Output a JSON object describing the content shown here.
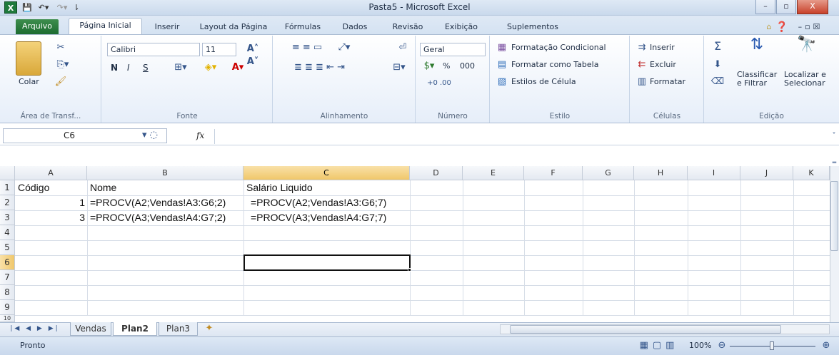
{
  "window": {
    "title": "Pasta5  -  Microsoft Excel",
    "app_icon": "X",
    "controls": [
      "–",
      "▫",
      "X"
    ]
  },
  "tabs": [
    "Arquivo",
    "Página Inicial",
    "Inserir",
    "Layout da Página",
    "Fórmulas",
    "Dados",
    "Revisão",
    "Exibição",
    "Suplementos"
  ],
  "ribbon": {
    "clipboard": {
      "label": "Área de Transf...",
      "paste": "Colar"
    },
    "font": {
      "label": "Fonte",
      "name": "Calibri",
      "size": "11",
      "bold": "N",
      "italic": "I",
      "underline": "S"
    },
    "alignment": {
      "label": "Alinhamento"
    },
    "number": {
      "label": "Número",
      "format": "Geral",
      "percent": "%",
      "thousands": "000"
    },
    "styles": {
      "label": "Estilo",
      "conditional": "Formatação Condicional",
      "as_table": "Formatar como Tabela",
      "cell_styles": "Estilos de Célula"
    },
    "cells": {
      "label": "Células",
      "insert": "Inserir",
      "delete": "Excluir",
      "format": "Formatar"
    },
    "editing": {
      "label": "Edição",
      "sort_l1": "Classificar",
      "sort_l2": "e Filtrar",
      "find_l1": "Localizar e",
      "find_l2": "Selecionar"
    }
  },
  "formula_bar": {
    "name_box": "C6",
    "fx": "fx",
    "formula": ""
  },
  "columns": [
    "A",
    "B",
    "C",
    "D",
    "E",
    "F",
    "G",
    "H",
    "I",
    "J",
    "K"
  ],
  "selected_column": "C",
  "rows": [
    "1",
    "2",
    "3",
    "4",
    "5",
    "6",
    "7",
    "8",
    "9",
    "10"
  ],
  "selected_row": "6",
  "cells": {
    "A1": "Código",
    "B1": "Nome",
    "C1": "Salário Liquido",
    "A2": "1",
    "B2": "=PROCV(A2;Vendas!A3:G6;2)",
    "C2": "=PROCV(A2;Vendas!A3:G6;7)",
    "A3": "3",
    "B3": "=PROCV(A3;Vendas!A4:G7;2)",
    "C3": "=PROCV(A3;Vendas!A4:G7;7)"
  },
  "sheets": [
    "Vendas",
    "Plan2",
    "Plan3"
  ],
  "active_sheet": "Plan2",
  "status": {
    "mode": "Pronto",
    "zoom": "100%"
  },
  "accent": {
    "excel_green": "#1f7a3c",
    "selection": "#f0c76a"
  }
}
